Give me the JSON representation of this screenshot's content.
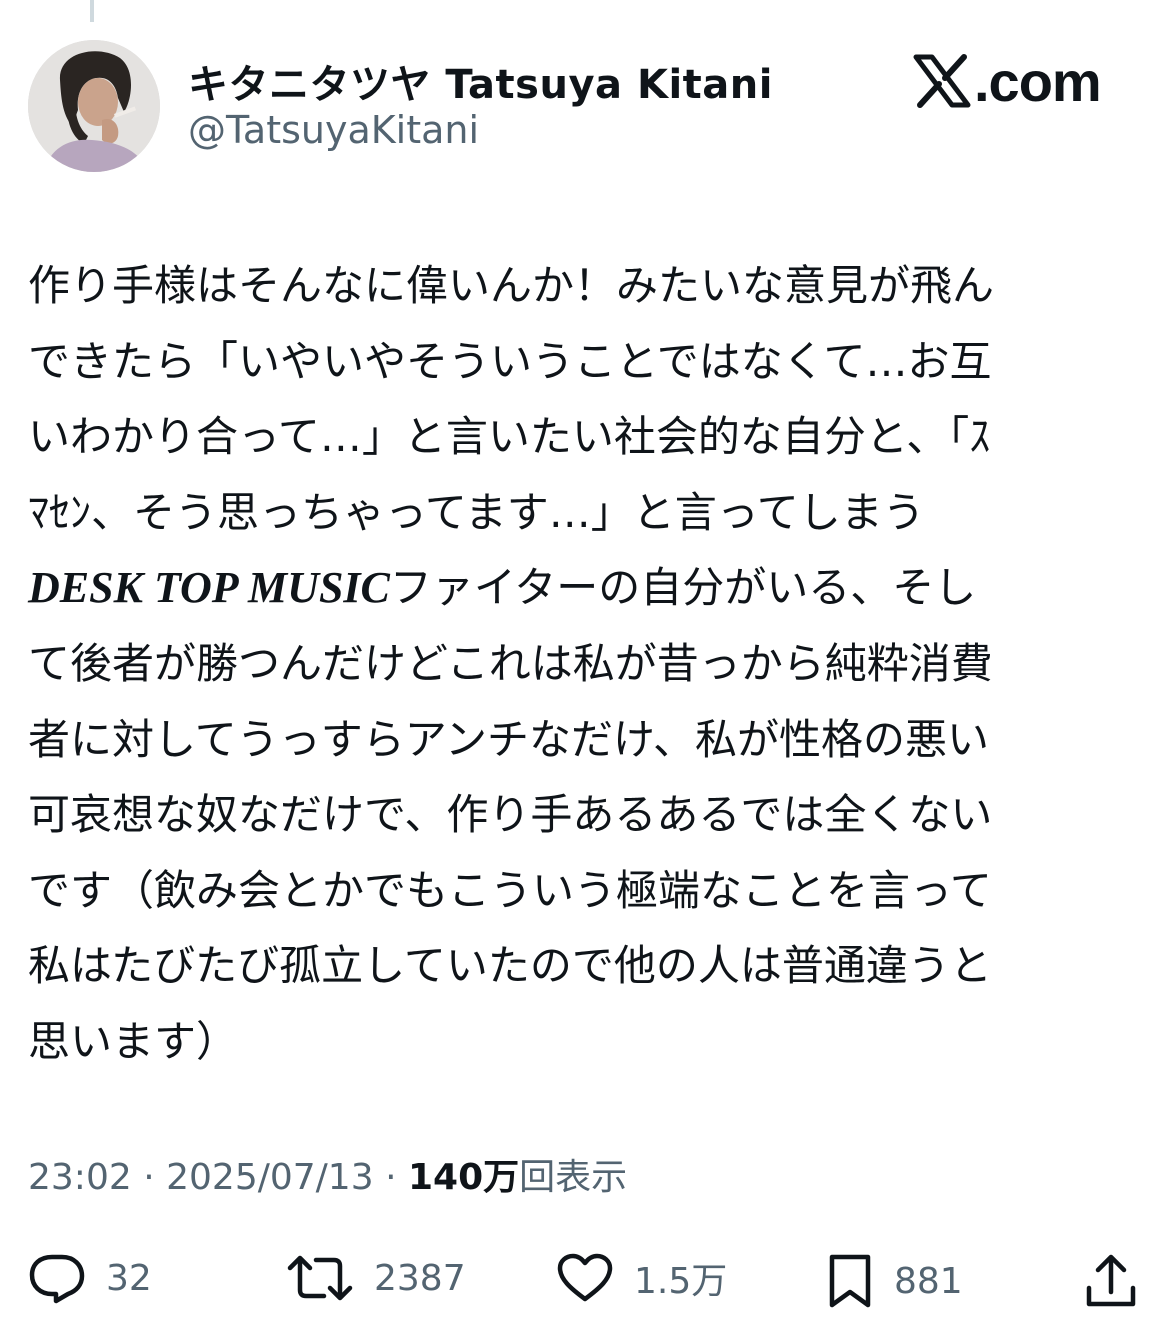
{
  "user": {
    "name": "キタニタツヤ Tatsuya Kitani",
    "handle": "@TatsuyaKitani",
    "avatar_icon": "avatar-photo"
  },
  "brand": {
    "text": ".com",
    "icon": "x-logo-icon"
  },
  "post": {
    "lines": [
      "作り手様はそんなに偉いんか！みたいな意見が飛ん",
      "できたら「いやいやそういうことではなくて…お互",
      "いわかり合って…」と言いたい社会的な自分と、「ｽ",
      "ﾏｾﾝ、そう思っちゃってます…」と言ってしまう",
      {
        "bold": "DESK TOP MUSIC",
        "rest": "ファイターの自分がいる、そし"
      },
      "て後者が勝つんだけどこれは私が昔っから純粋消費",
      "者に対してうっすらアンチなだけ、私が性格の悪い",
      "可哀想な奴なだけで、作り手あるあるでは全くない",
      "です（飲み会とかでもこういう極端なことを言って",
      "私はたびたび孤立していたので他の人は普通違うと",
      "思います）"
    ]
  },
  "meta": {
    "time": "23:02",
    "date": "2025/07/13",
    "separator": "·",
    "views_count": "140万",
    "views_label": "回表示"
  },
  "actions": {
    "replies": {
      "icon": "reply-icon",
      "count": "32"
    },
    "reposts": {
      "icon": "repost-icon",
      "count": "2387"
    },
    "likes": {
      "icon": "heart-icon",
      "count": "1.5万"
    },
    "bookmarks": {
      "icon": "bookmark-icon",
      "count": "881"
    },
    "share": {
      "icon": "share-icon"
    }
  },
  "colors": {
    "text": "#0f1419",
    "secondary": "#536471",
    "thread_line": "#cfd9de"
  }
}
